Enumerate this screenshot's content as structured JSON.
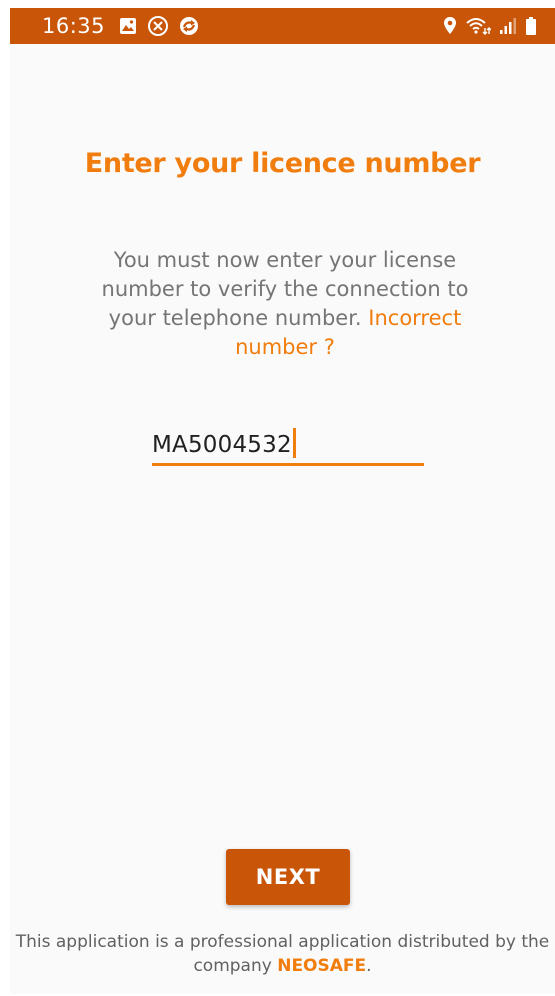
{
  "status_bar": {
    "time": "16:35",
    "left_icons": [
      "gallery-icon",
      "blocked-icon",
      "sync-icon"
    ],
    "right_icons": [
      "location-icon",
      "wifi-icon",
      "signal-icon",
      "battery-icon"
    ],
    "color": "#c85508"
  },
  "screen": {
    "title": "Enter your licence number",
    "description_main": "You must now enter your license number to verify the connection to your telephone number.",
    "incorrect_link": "Incorrect number ?"
  },
  "license_input": {
    "value": "MA5004532"
  },
  "next_label": "NEXT",
  "footer": {
    "line_text": "This application is a professional application distributed by the company",
    "company": "NEOSAFE",
    "period": "."
  },
  "colors": {
    "accent": "#f07d0e",
    "primary_dark": "#c85508",
    "text_gray": "#757575"
  }
}
